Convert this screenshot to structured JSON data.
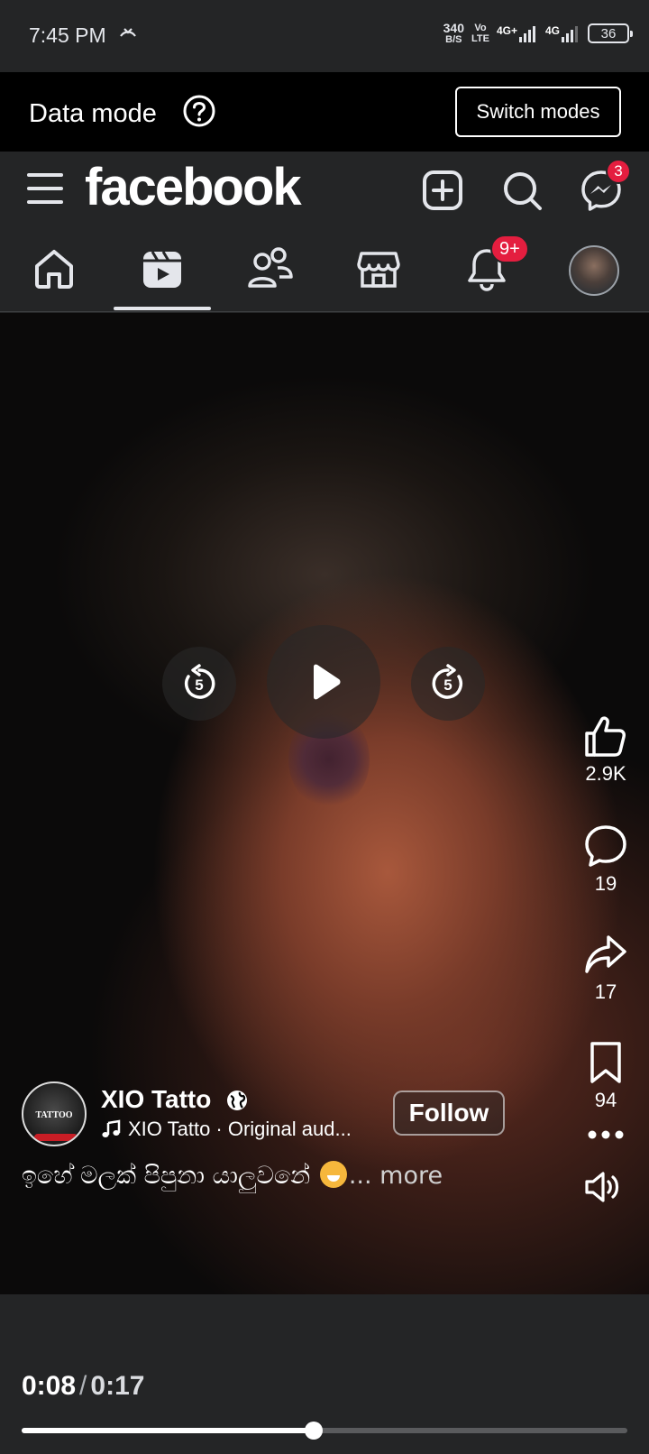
{
  "status_bar": {
    "time": "7:45 PM",
    "net_speed_value": "340",
    "net_speed_unit": "B/S",
    "volte_top": "Vo",
    "volte_bottom": "LTE",
    "network_1": "4G+",
    "network_2": "4G",
    "battery": "36"
  },
  "data_mode": {
    "label": "Data mode",
    "switch_label": "Switch modes"
  },
  "header": {
    "logo": "facebook",
    "messenger_badge": "3"
  },
  "tabs": {
    "notifications_badge": "9+",
    "active": "video"
  },
  "video": {
    "rewind_seconds": "5",
    "forward_seconds": "5",
    "likes": "2.9K",
    "comments": "19",
    "shares": "17",
    "saves": "94",
    "author": "XIO Tatto",
    "audio": "XIO Tatto · Original aud...",
    "follow_label": "Follow",
    "caption": "ඉහේ මලක් පිපුනා යාලුවනේ",
    "caption_more": "... more",
    "author_logo_text": "TATTOO"
  },
  "playback": {
    "current": "0:08",
    "separator": "/",
    "total": "0:17",
    "progress": 0.482
  },
  "colors": {
    "badge_red": "#e41e3f",
    "surface": "#242526"
  }
}
